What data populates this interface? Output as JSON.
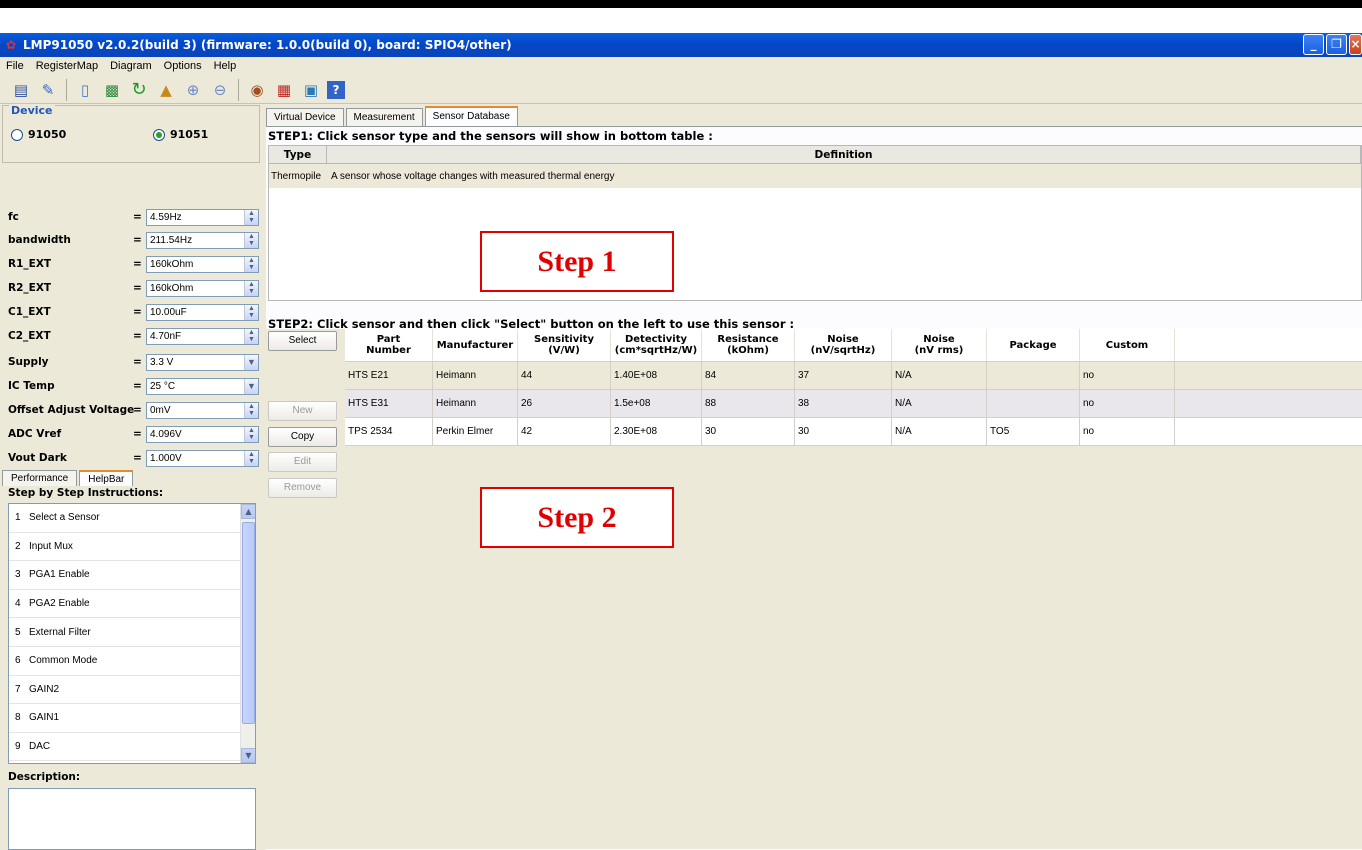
{
  "window": {
    "title": "LMP91050 v2.0.2(build 3) (firmware: 1.0.0(build 0), board: SPIO4/other)"
  },
  "menu": [
    "File",
    "RegisterMap",
    "Diagram",
    "Options",
    "Help"
  ],
  "toolbar": [
    "save-icon",
    "edit-icon",
    "open-icon",
    "export-csv-icon",
    "refresh-icon",
    "upload-icon",
    "zoom-in-icon",
    "zoom-out-icon",
    "film-icon",
    "pdf-icon",
    "image-icon",
    "help-icon"
  ],
  "device": {
    "legend": "Device",
    "options": [
      {
        "label": "91050",
        "selected": false
      },
      {
        "label": "91051",
        "selected": true
      }
    ]
  },
  "params": [
    {
      "label": "fc",
      "value": "4.59Hz",
      "ctrl": "spin"
    },
    {
      "label": "bandwidth",
      "value": "211.54Hz",
      "ctrl": "spin"
    },
    {
      "label": "R1_EXT",
      "value": "160kOhm",
      "ctrl": "spin"
    },
    {
      "label": "R2_EXT",
      "value": "160kOhm",
      "ctrl": "spin"
    },
    {
      "label": "C1_EXT",
      "value": "10.00uF",
      "ctrl": "spin"
    },
    {
      "label": "C2_EXT",
      "value": "4.70nF",
      "ctrl": "spin"
    },
    {
      "label": "Supply",
      "value": "3.3 V",
      "ctrl": "combo"
    },
    {
      "label": "IC Temp",
      "value": "25 °C",
      "ctrl": "combo"
    },
    {
      "label": "Offset Adjust Voltage",
      "value": "0mV",
      "ctrl": "spin"
    },
    {
      "label": "ADC Vref",
      "value": "4.096V",
      "ctrl": "spin"
    },
    {
      "label": "Vout Dark",
      "value": "1.000V",
      "ctrl": "spin"
    }
  ],
  "left_tabs": [
    "Performance",
    "HelpBar"
  ],
  "instructions": {
    "title": "Step by Step Instructions:",
    "items": [
      {
        "num": "1",
        "text": "Select a Sensor"
      },
      {
        "num": "2",
        "text": "Input Mux"
      },
      {
        "num": "3",
        "text": "PGA1 Enable"
      },
      {
        "num": "4",
        "text": "PGA2 Enable"
      },
      {
        "num": "5",
        "text": "External Filter"
      },
      {
        "num": "6",
        "text": "Common Mode"
      },
      {
        "num": "7",
        "text": "GAIN2"
      },
      {
        "num": "8",
        "text": "GAIN1"
      },
      {
        "num": "9",
        "text": "DAC"
      }
    ],
    "description_title": "Description:"
  },
  "right_tabs": [
    "Virtual Device",
    "Measurement",
    "Sensor Database"
  ],
  "step1": {
    "label": "STEP1: Click sensor type and the sensors will show in bottom table :",
    "columns": [
      "Type",
      "Definition"
    ],
    "rows": [
      {
        "type": "Thermopile",
        "definition": "A sensor whose voltage changes with measured thermal energy"
      }
    ],
    "callout": "Step 1"
  },
  "step2": {
    "label": "STEP2: Click sensor and then click \"Select\" button on the left to use this sensor :",
    "buttons": {
      "select": "Select",
      "new": "New",
      "copy": "Copy",
      "edit": "Edit",
      "remove": "Remove"
    },
    "columns": [
      "Part\nNumber",
      "Manufacturer",
      "Sensitivity\n(V/W)",
      "Detectivity\n(cm*sqrtHz/W)",
      "Resistance\n(kOhm)",
      "Noise\n(nV/sqrtHz)",
      "Noise\n(nV rms)",
      "Package",
      "Custom"
    ],
    "rows": [
      [
        "HTS E21",
        "Heimann",
        "44",
        "1.40E+08",
        "84",
        "37",
        "N/A",
        "",
        "no"
      ],
      [
        "HTS E31",
        "Heimann",
        "26",
        "1.5e+08",
        "88",
        "38",
        "N/A",
        "",
        "no"
      ],
      [
        "TPS 2534",
        "Perkin Elmer",
        "42",
        "2.30E+08",
        "30",
        "30",
        "N/A",
        "TO5",
        "no"
      ]
    ],
    "callout": "Step 2"
  }
}
